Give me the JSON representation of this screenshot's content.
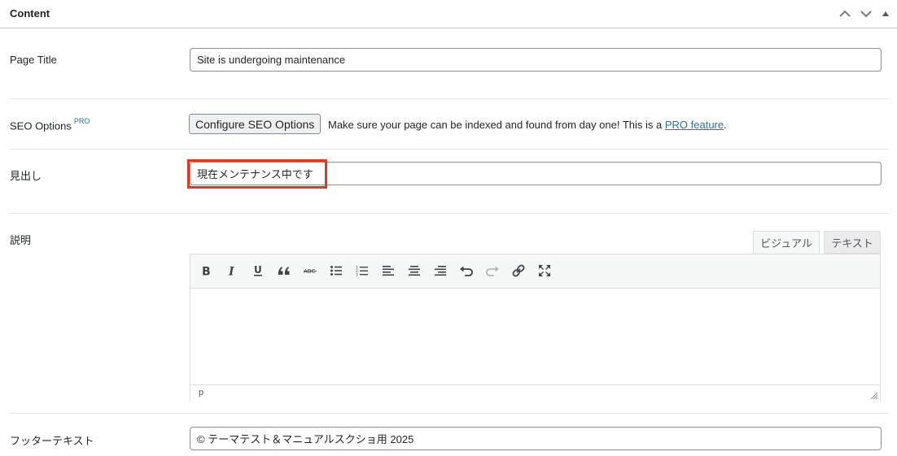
{
  "panel": {
    "title": "Content"
  },
  "fields": {
    "page_title": {
      "label": "Page Title",
      "value": "Site is undergoing maintenance"
    },
    "seo": {
      "label": "SEO Options",
      "badge": "PRO",
      "button": "Configure SEO Options",
      "desc_before": "Make sure your page can be indexed and found from day one! This is a ",
      "link": "PRO feature",
      "desc_after": "."
    },
    "headline": {
      "label": "見出し",
      "value": "現在メンテナンス中です"
    },
    "description": {
      "label": "説明",
      "tabs": {
        "visual": "ビジュアル",
        "text": "テキスト"
      },
      "path": "p",
      "toolbar": [
        "bold-icon",
        "italic-icon",
        "underline-icon",
        "blockquote-icon",
        "strikethrough-icon",
        "bullet-list-icon",
        "numbered-list-icon",
        "align-left-icon",
        "align-center-icon",
        "align-right-icon",
        "undo-icon",
        "redo-icon",
        "link-icon",
        "fullscreen-icon"
      ]
    },
    "footer": {
      "label": "フッターテキスト",
      "value": "© テーマテスト＆マニュアルスクショ用 2025"
    }
  },
  "colors": {
    "highlight": "#e0371f",
    "link": "#2271b1"
  }
}
